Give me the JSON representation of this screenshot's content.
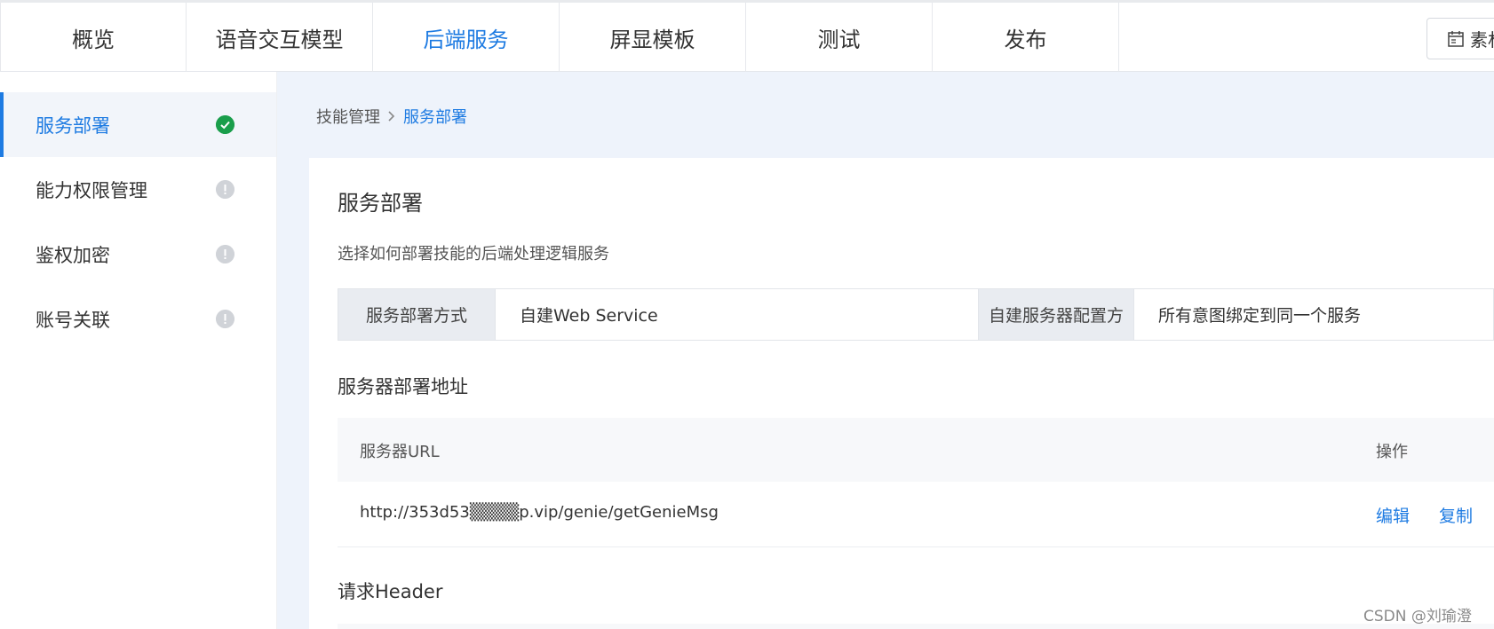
{
  "topnav": {
    "tabs": [
      {
        "label": "概览",
        "active": false
      },
      {
        "label": "语音交互模型",
        "active": false
      },
      {
        "label": "后端服务",
        "active": true
      },
      {
        "label": "屏显模板",
        "active": false
      },
      {
        "label": "测试",
        "active": false
      },
      {
        "label": "发布",
        "active": false
      }
    ],
    "material_button_label": "素材"
  },
  "sidebar": {
    "items": [
      {
        "label": "服务部署",
        "status": "complete",
        "active": true
      },
      {
        "label": "能力权限管理",
        "status": "incomplete",
        "active": false
      },
      {
        "label": "鉴权加密",
        "status": "incomplete",
        "active": false
      },
      {
        "label": "账号关联",
        "status": "incomplete",
        "active": false
      }
    ]
  },
  "breadcrumb": {
    "parent": "技能管理",
    "current": "服务部署"
  },
  "main": {
    "title": "服务部署",
    "description": "选择如何部署技能的后端处理逻辑服务",
    "config": {
      "deploy_method_label": "服务部署方式",
      "deploy_method_value": "自建Web Service",
      "server_config_label": "自建服务器配置方",
      "server_config_value": "所有意图绑定到同一个服务"
    },
    "server_section_title": "服务器部署地址",
    "table": {
      "col_url": "服务器URL",
      "col_actions": "操作",
      "rows": [
        {
          "url": "http://353d53▒▒▒▒p.vip/genie/getGenieMsg",
          "edit": "编辑",
          "copy": "复制"
        }
      ]
    },
    "header_section_title": "请求Header"
  },
  "watermark": "CSDN @刘瑜澄",
  "colors": {
    "accent": "#1e7be2",
    "ok": "#1a9e4b",
    "warn": "#d0d3d8",
    "content_bg": "#eef3fb"
  }
}
